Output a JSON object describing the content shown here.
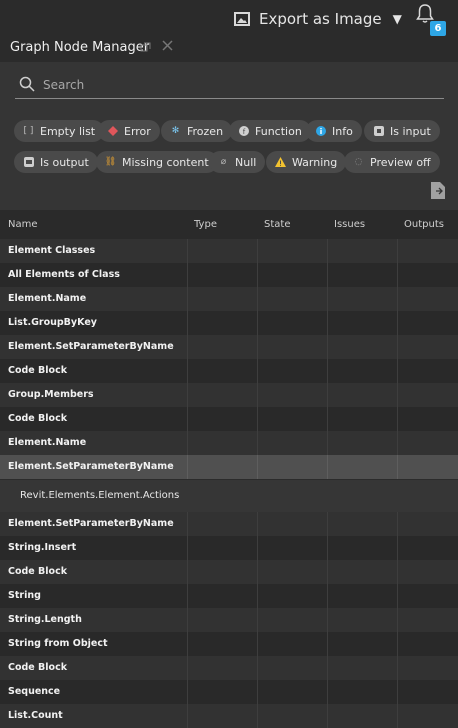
{
  "topbar": {
    "export_label": "Export as Image",
    "export_caret": "▼",
    "notification_count": "6"
  },
  "panel": {
    "title": "Graph Node Manager",
    "search_placeholder": "Search",
    "filters": [
      {
        "label": "Empty list",
        "icon": "bracket-icon"
      },
      {
        "label": "Error",
        "icon": "error-diamond-icon"
      },
      {
        "label": "Frozen",
        "icon": "snowflake-icon"
      },
      {
        "label": "Function",
        "icon": "function-icon"
      },
      {
        "label": "Info",
        "icon": "info-icon"
      },
      {
        "label": "Is input",
        "icon": "input-icon"
      },
      {
        "label": "Is output",
        "icon": "output-icon"
      },
      {
        "label": "Missing content",
        "icon": "link-icon"
      },
      {
        "label": "Null",
        "icon": "null-icon"
      },
      {
        "label": "Warning",
        "icon": "warning-icon"
      },
      {
        "label": "Preview off",
        "icon": "eye-off-icon"
      }
    ]
  },
  "table": {
    "headers": [
      "Name",
      "Type",
      "State",
      "Issues",
      "Outputs"
    ],
    "rows": [
      "Element Classes",
      "All Elements of Class",
      "Element.Name",
      "List.GroupByKey",
      "Element.SetParameterByName",
      "Code Block",
      "Group.Members",
      "Code Block",
      "Element.Name",
      "Element.SetParameterByName",
      "Element.SetParameterByName",
      "String.Insert",
      "Code Block",
      "String",
      "String.Length",
      "String from Object",
      "Code Block",
      "Sequence",
      "List.Count"
    ],
    "detail_text": "Revit.Elements.Element.Actions"
  },
  "colors": {
    "accent": "#2ea6e6",
    "error": "#e0565b",
    "warning": "#f2c230",
    "info": "#2ea6e6"
  }
}
